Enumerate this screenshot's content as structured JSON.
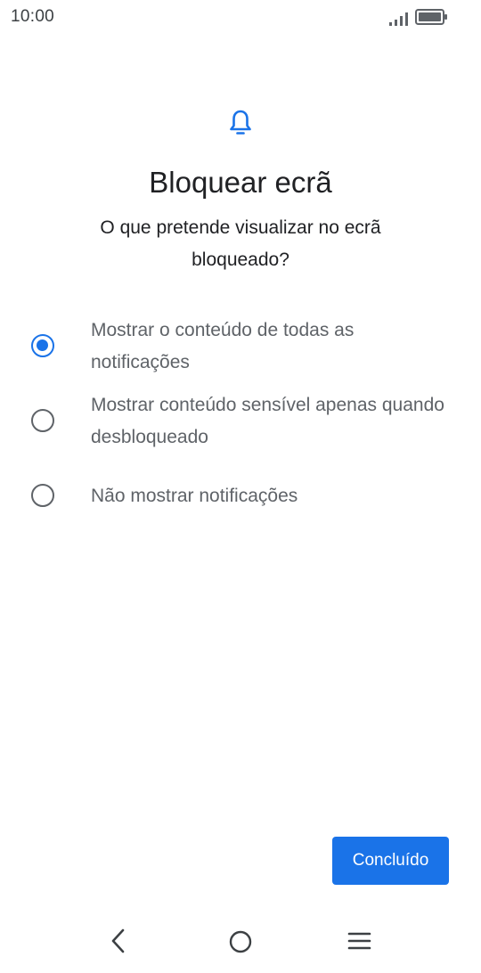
{
  "status_bar": {
    "time": "10:00",
    "icons": [
      "signal-icon",
      "battery-icon"
    ]
  },
  "header": {
    "icon": "bell-icon",
    "accent_color": "#1a73e8",
    "title": "Bloquear ecrã",
    "subtitle": "O que pretende visualizar no ecrã bloqueado?"
  },
  "options": [
    {
      "label": "Mostrar o conteúdo de todas as notificações",
      "selected": true
    },
    {
      "label": "Mostrar conteúdo sensível apenas quando desbloqueado",
      "selected": false
    },
    {
      "label": "Não mostrar notificações",
      "selected": false
    }
  ],
  "actions": {
    "done_label": "Concluído",
    "done_color": "#1a73e8"
  },
  "nav_bar": {
    "icons": [
      "back-icon",
      "home-icon",
      "menu-icon"
    ]
  }
}
